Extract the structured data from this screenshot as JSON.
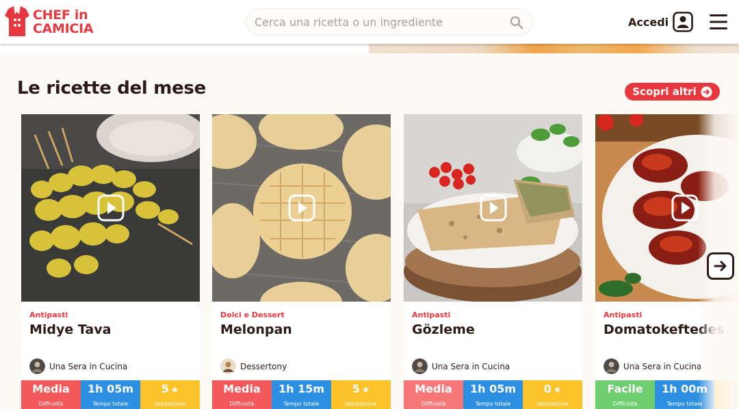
{
  "header": {
    "logo_line1": "CHEF in",
    "logo_line2": "CAMICIA",
    "search_placeholder": "Cerca una ricetta o un ingrediente",
    "login_label": "Accedi"
  },
  "section": {
    "title": "Le ricette del mese",
    "more_label": "Scopri altri"
  },
  "colors": {
    "brand_red": "#e8383f",
    "difficulty_red": "#f3585a",
    "difficulty_easy": "#6fce70",
    "time_blue": "#2d8fe2",
    "rating_yellow": "#fbc22a"
  },
  "cards": [
    {
      "category": "Antipasti",
      "title": "Midye Tava",
      "author": "Una Sera in Cucina",
      "difficulty": "Media",
      "difficulty_label": "Difficoltà",
      "time": "1h 05m",
      "time_label": "Tempo totale",
      "rating": "5",
      "rating_label": "Valutazione"
    },
    {
      "category": "Dolci e Dessert",
      "title": "Melonpan",
      "author": "Dessertony",
      "difficulty": "Media",
      "difficulty_label": "Difficoltà",
      "time": "1h 15m",
      "time_label": "Tempo totale",
      "rating": "5",
      "rating_label": "Valutazione"
    },
    {
      "category": "Antipasti",
      "title": "Gözleme",
      "author": "Una Sera in Cucina",
      "difficulty": "Media",
      "difficulty_label": "Difficoltà",
      "time": "1h 05m",
      "time_label": "Tempo totale",
      "rating": "0",
      "rating_label": "Valutazione"
    },
    {
      "category": "Antipasti",
      "title": "Domatokeftedes",
      "author": "Una Sera in Cucina",
      "difficulty": "Facile",
      "difficulty_label": "Difficoltà",
      "time": "1h 00m",
      "time_label": "Tempo totale",
      "rating": "",
      "rating_label": ""
    }
  ]
}
